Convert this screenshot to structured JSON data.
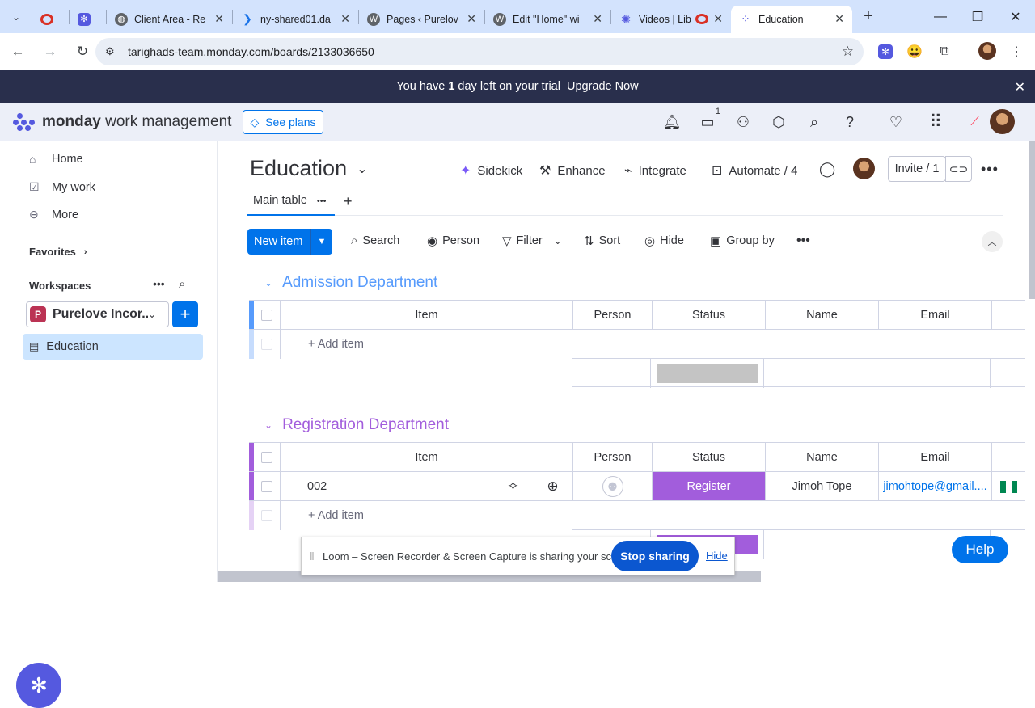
{
  "browser": {
    "tabs": [
      {
        "title": "",
        "icon": "record-icon",
        "color": "#d93025"
      },
      {
        "title": "",
        "icon": "extension-icon",
        "color": "#5559df"
      },
      {
        "title": "Client Area - Re",
        "icon": "globe-icon",
        "color": "#5f6368"
      },
      {
        "title": "ny-shared01.da",
        "icon": "chevron-icon",
        "color": "#1a73e8"
      },
      {
        "title": "Pages ‹ Purelov",
        "icon": "wordpress-icon",
        "color": "#5f6368"
      },
      {
        "title": "Edit \"Home\" wi",
        "icon": "wordpress-icon",
        "color": "#5f6368"
      },
      {
        "title": "Videos | Lib",
        "icon": "loom-icon",
        "color": "#5559df"
      },
      {
        "title": "Education",
        "icon": "monday-icon",
        "color": "#5559df"
      }
    ],
    "url": "tarighads-team.monday.com/boards/2133036650"
  },
  "trial": {
    "before": "You have ",
    "days": "1",
    "after": " day left on your trial",
    "upgrade": "Upgrade Now"
  },
  "header": {
    "brand_bold": "monday",
    "brand_rest": " work management",
    "see_plans": "See plans",
    "inbox_badge": "1"
  },
  "sidebar": {
    "home": "Home",
    "my_work": "My work",
    "more": "More",
    "favorites": "Favorites",
    "workspaces": "Workspaces",
    "workspace_badge": "P",
    "workspace_name": "Purelove Incor...",
    "board": "Education"
  },
  "board": {
    "title": "Education",
    "sidekick": "Sidekick",
    "enhance": "Enhance",
    "integrate": "Integrate",
    "automate": "Automate / 4",
    "invite": "Invite / 1",
    "main_tab": "Main table"
  },
  "toolbar": {
    "new_item": "New item",
    "search": "Search",
    "person": "Person",
    "filter": "Filter",
    "sort": "Sort",
    "hide": "Hide",
    "group_by": "Group by"
  },
  "columns": [
    "Item",
    "Person",
    "Status",
    "Name",
    "Email"
  ],
  "groups": [
    {
      "title": "Admission Department",
      "color": "#579bfc",
      "add_item": "+ Add item",
      "rows": []
    },
    {
      "title": "Registration Department",
      "color": "#a25ddc",
      "add_item": "+ Add item",
      "rows": [
        {
          "item": "002",
          "person": "",
          "status": "Register",
          "name": "Jimoh Tope",
          "email": "jimohtope@gmail...."
        }
      ]
    }
  ],
  "loom": {
    "message": "Loom – Screen Recorder & Screen Capture is sharing your screen.",
    "stop": "Stop sharing",
    "hide": "Hide"
  },
  "help": "Help",
  "colors": {
    "accent": "#0073ea",
    "status_register": "#a25ddc",
    "status_empty": "#c4c4c4",
    "topbar": "#292f4c"
  }
}
